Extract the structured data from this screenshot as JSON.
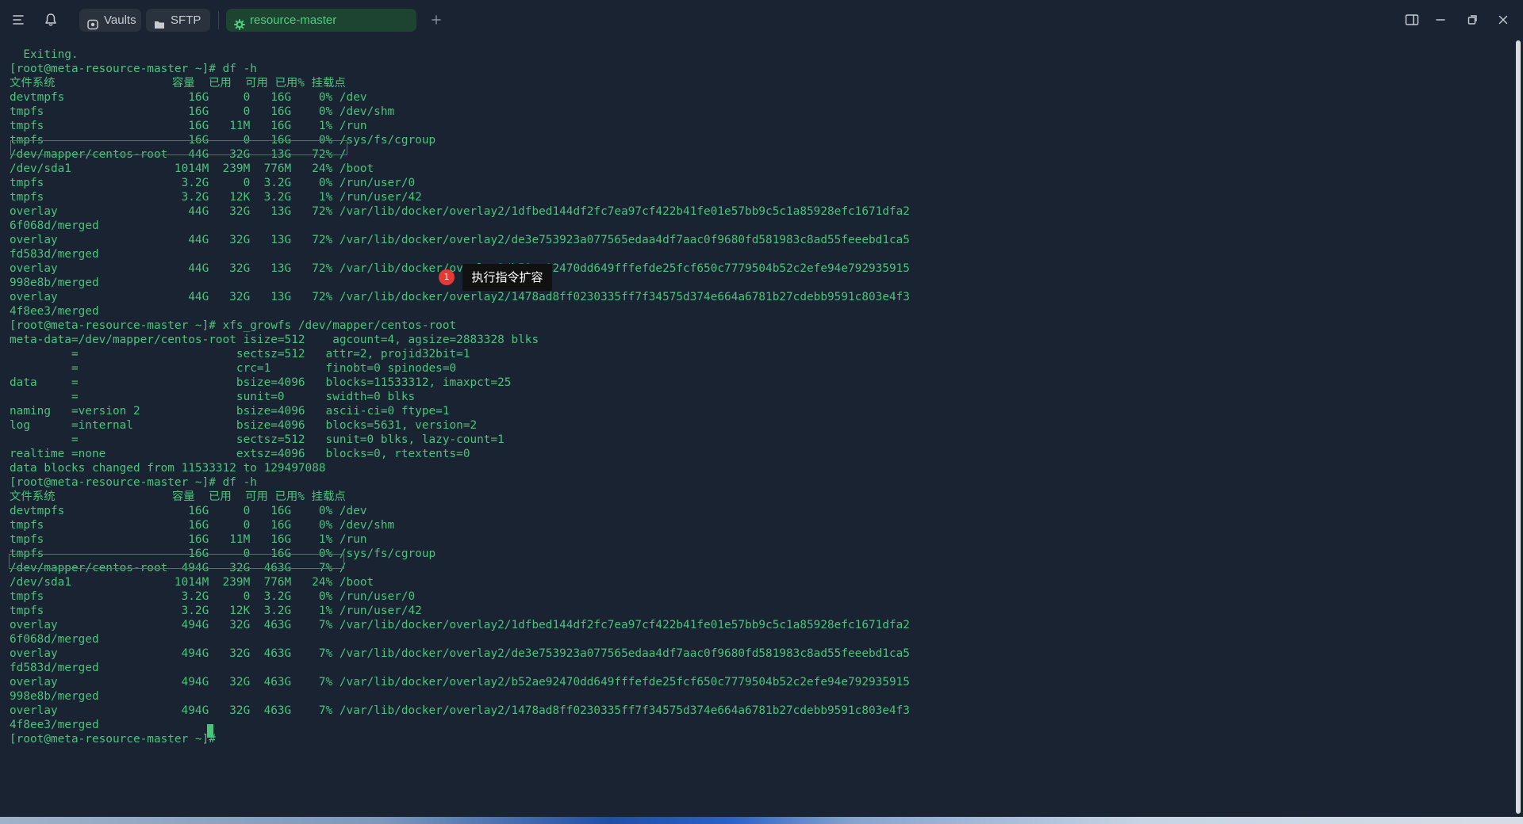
{
  "titlebar": {
    "tabs": [
      {
        "label": "Vaults",
        "icon": "vault-icon"
      },
      {
        "label": "SFTP",
        "icon": "folder-icon"
      },
      {
        "label": "resource-master",
        "icon": "gear-icon",
        "active": true
      }
    ],
    "accent_color": "#4fcf82"
  },
  "terminal": {
    "lines": [
      "  Exiting.",
      "[root@meta-resource-master ~]# df -h",
      "文件系统                 容量  已用  可用 已用% 挂载点",
      "devtmpfs                  16G     0   16G    0% /dev",
      "tmpfs                     16G     0   16G    0% /dev/shm",
      "tmpfs                     16G   11M   16G    1% /run",
      "tmpfs                     16G     0   16G    0% /sys/fs/cgroup",
      "/dev/mapper/centos-root   44G   32G   13G   72% /",
      "/dev/sda1               1014M  239M  776M   24% /boot",
      "tmpfs                    3.2G     0  3.2G    0% /run/user/0",
      "tmpfs                    3.2G   12K  3.2G    1% /run/user/42",
      "overlay                   44G   32G   13G   72% /var/lib/docker/overlay2/1dfbed144df2fc7ea97cf422b41fe01e57bb9c5c1a85928efc1671dfa2",
      "6f068d/merged",
      "overlay                   44G   32G   13G   72% /var/lib/docker/overlay2/de3e753923a077565edaa4df7aac0f9680fd581983c8ad55feeebd1ca5",
      "fd583d/merged",
      "overlay                   44G   32G   13G   72% /var/lib/docker/overlay2/b52ae92470dd649fffefde25fcf650c7779504b52c2efe94e792935915",
      "998e8b/merged",
      "overlay                   44G   32G   13G   72% /var/lib/docker/overlay2/1478ad8ff0230335ff7f34575d374e664a6781b27cdebb9591c803e4f3",
      "4f8ee3/merged",
      "[root@meta-resource-master ~]# xfs_growfs /dev/mapper/centos-root",
      "meta-data=/dev/mapper/centos-root isize=512    agcount=4, agsize=2883328 blks",
      "         =                       sectsz=512   attr=2, projid32bit=1",
      "         =                       crc=1        finobt=0 spinodes=0",
      "data     =                       bsize=4096   blocks=11533312, imaxpct=25",
      "         =                       sunit=0      swidth=0 blks",
      "naming   =version 2              bsize=4096   ascii-ci=0 ftype=1",
      "log      =internal               bsize=4096   blocks=5631, version=2",
      "         =                       sectsz=512   sunit=0 blks, lazy-count=1",
      "realtime =none                   extsz=4096   blocks=0, rtextents=0",
      "data blocks changed from 11533312 to 129497088",
      "[root@meta-resource-master ~]# df -h",
      "文件系统                 容量  已用  可用 已用% 挂载点",
      "devtmpfs                  16G     0   16G    0% /dev",
      "tmpfs                     16G     0   16G    0% /dev/shm",
      "tmpfs                     16G   11M   16G    1% /run",
      "tmpfs                     16G     0   16G    0% /sys/fs/cgroup",
      "/dev/mapper/centos-root  494G   32G  463G    7% /",
      "/dev/sda1               1014M  239M  776M   24% /boot",
      "tmpfs                    3.2G     0  3.2G    0% /run/user/0",
      "tmpfs                    3.2G   12K  3.2G    1% /run/user/42",
      "overlay                  494G   32G  463G    7% /var/lib/docker/overlay2/1dfbed144df2fc7ea97cf422b41fe01e57bb9c5c1a85928efc1671dfa2",
      "6f068d/merged",
      "overlay                  494G   32G  463G    7% /var/lib/docker/overlay2/de3e753923a077565edaa4df7aac0f9680fd581983c8ad55feeebd1ca5",
      "fd583d/merged",
      "overlay                  494G   32G  463G    7% /var/lib/docker/overlay2/b52ae92470dd649fffefde25fcf650c7779504b52c2efe94e792935915",
      "998e8b/merged",
      "overlay                  494G   32G  463G    7% /var/lib/docker/overlay2/1478ad8ff0230335ff7f34575d374e664a6781b27cdebb9591c803e4f3",
      "4f8ee3/merged",
      "[root@meta-resource-master ~]# "
    ],
    "text_color": "#4cc37b",
    "background": "#1a2332",
    "highlight_color": "#d23b3b"
  },
  "annotation": {
    "badge": "1",
    "label": "执行指令扩容"
  }
}
